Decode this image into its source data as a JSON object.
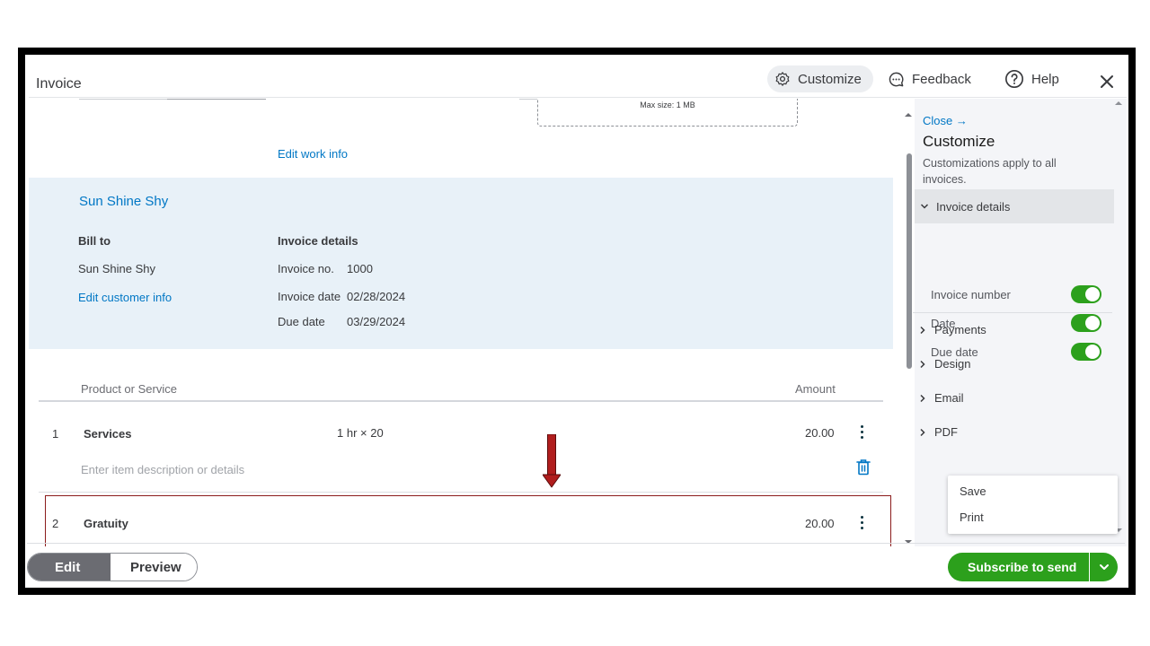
{
  "header": {
    "title": "Invoice",
    "customize_label": "Customize",
    "feedback_label": "Feedback",
    "help_label": "Help"
  },
  "upload": {
    "max_size": "Max size: 1 MB"
  },
  "work": {
    "edit_link": "Edit work info"
  },
  "customer": {
    "name": "Sun Shine Shy",
    "bill_to_label": "Bill to",
    "bill_to_name": "Sun Shine Shy",
    "edit_link": "Edit customer info"
  },
  "invoice_details": {
    "heading": "Invoice details",
    "number_label": "Invoice no.",
    "number_value": "1000",
    "date_label": "Invoice date",
    "date_value": "02/28/2024",
    "due_label": "Due date",
    "due_value": "03/29/2024"
  },
  "table": {
    "col_product": "Product or Service",
    "col_amount": "Amount",
    "rows": [
      {
        "num": "1",
        "name": "Services",
        "qty": "1 hr × 20",
        "amount": "20.00",
        "desc_placeholder": "Enter item description or details"
      },
      {
        "num": "2",
        "name": "Gratuity",
        "amount": "20.00"
      }
    ]
  },
  "side": {
    "close_link": "Close →",
    "title": "Customize",
    "subtitle": "Customizations apply to all invoices.",
    "open_section": "Invoice details",
    "toggles": [
      {
        "label": "Invoice number",
        "on": true
      },
      {
        "label": "Date",
        "on": true
      },
      {
        "label": "Due date",
        "on": true
      }
    ],
    "sections": [
      "Payments",
      "Design",
      "Email",
      "PDF"
    ]
  },
  "menu": {
    "save": "Save",
    "print": "Print"
  },
  "footer": {
    "edit_label": "Edit",
    "preview_label": "Preview",
    "send_label": "Subscribe to send"
  },
  "colors": {
    "accent_green": "#2ca01c",
    "link_blue": "#0077c5",
    "highlight_red": "#8b1c1c",
    "customer_bg": "#e8f1f8"
  }
}
